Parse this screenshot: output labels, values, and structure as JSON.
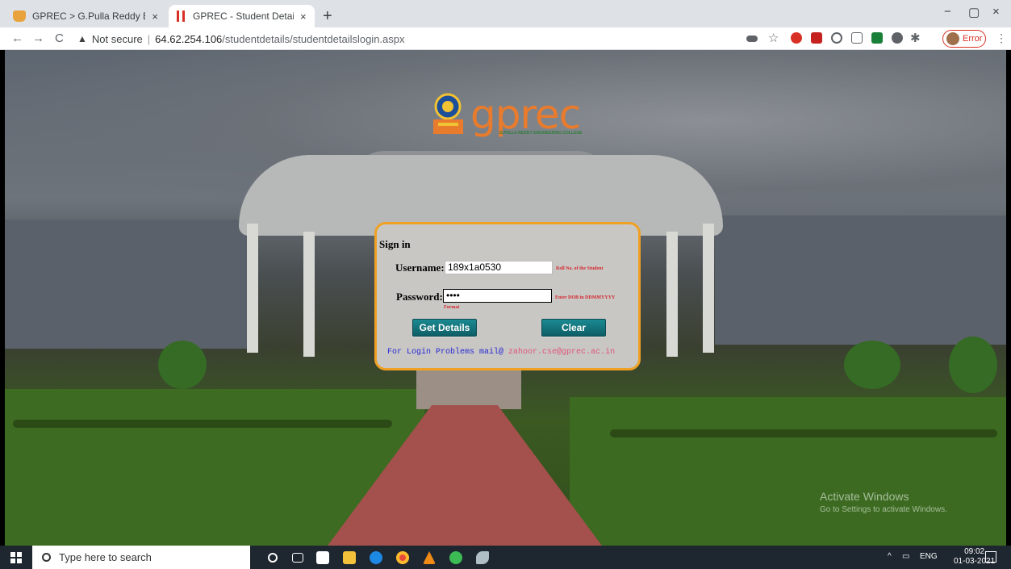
{
  "browser": {
    "tabs": [
      {
        "title": "GPREC > G.Pulla Reddy Engineer",
        "close": "×",
        "active": false
      },
      {
        "title": "GPREC - Student Details - LOGIN",
        "close": "×",
        "active": true
      }
    ],
    "new_tab": "+",
    "window_controls": {
      "minimize": "−",
      "maximize": "▢",
      "close": "×"
    },
    "nav": {
      "back": "←",
      "forward": "→",
      "reload": "C"
    },
    "security_label": "Not secure",
    "url_host": "64.62.254.106",
    "url_path": "/studentdetails/studentdetailslogin.aspx",
    "profile_label": "Error",
    "menu": "⋮"
  },
  "page": {
    "logo": {
      "word": "gprec",
      "subtitle": "G.PULLA REDDY ENGINEERING COLLEGE"
    },
    "login": {
      "title": "Sign in",
      "username_label": "Username:",
      "username_value": "189x1a0530",
      "username_hint": "Roll No. of the Student",
      "password_label": "Password:",
      "password_value": "••••",
      "password_hint": "Enter DOB in DDMMYYYY",
      "password_hint_2": "Format",
      "details_button": "Get Details",
      "clear_button": "Clear",
      "help_text": "For Login Problems mail@",
      "help_email": "zahoor.cse@gprec.ac.in"
    },
    "watermark": {
      "line1": "Activate Windows",
      "line2": "Go to Settings to activate Windows."
    }
  },
  "taskbar": {
    "search_placeholder": "Type here to search",
    "tray_language": "ENG",
    "time": "09:02",
    "date": "01-03-2021"
  },
  "colors": {
    "login_border": "#f0a124",
    "login_bg": "#c8c7c4",
    "button_teal": "#127480",
    "hint_red": "#d6272d",
    "help_blue": "#2727d6",
    "help_pink": "#e05577",
    "logo_orange": "#e97b2d"
  }
}
